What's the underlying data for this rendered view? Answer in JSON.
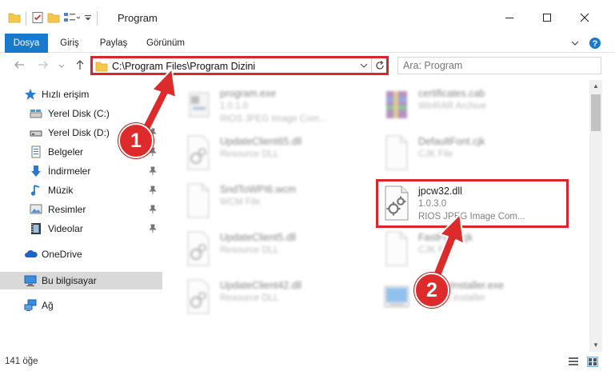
{
  "window": {
    "title": "Program",
    "controls": [
      "minimize-icon",
      "maximize-icon",
      "close-icon"
    ]
  },
  "ribbon": {
    "tabs": [
      {
        "label": "Dosya",
        "active": true
      },
      {
        "label": "Giriş"
      },
      {
        "label": "Paylaş"
      },
      {
        "label": "Görünüm"
      }
    ]
  },
  "navigation": {
    "address": "C:\\Program Files\\Program Dizini",
    "search_placeholder": "Ara: Program"
  },
  "sidebar": {
    "items": [
      {
        "label": "Hızlı erişim",
        "icon": "star-icon"
      },
      {
        "label": "Yerel Disk (C:)",
        "icon": "drive-icon",
        "pinned": true
      },
      {
        "label": "Yerel Disk (D:)",
        "icon": "drive-icon",
        "pinned": true
      },
      {
        "label": "Belgeler",
        "icon": "document-icon",
        "pinned": true
      },
      {
        "label": "İndirmeler",
        "icon": "download-icon",
        "pinned": true
      },
      {
        "label": "Müzik",
        "icon": "music-icon",
        "pinned": true
      },
      {
        "label": "Resimler",
        "icon": "image-icon",
        "pinned": true
      },
      {
        "label": "Videolar",
        "icon": "video-icon",
        "pinned": true
      },
      {
        "label": "OneDrive",
        "icon": "cloud-icon"
      },
      {
        "label": "Bu bilgisayar",
        "icon": "computer-icon",
        "selected": true
      },
      {
        "label": "Ağ",
        "icon": "network-icon"
      }
    ]
  },
  "files": [
    {
      "name": "program.exe",
      "line2": "1.0.1.0",
      "line3": "RIOS JPEG Image Com...",
      "icon": "exe-icon",
      "blurred": true
    },
    {
      "name": "certificates.cab",
      "line2": "WinRAR Archive",
      "line3": "",
      "icon": "archive-icon",
      "blurred": true
    },
    {
      "name": "UpdateClient65.dll",
      "line2": "Resource DLL",
      "line3": "",
      "icon": "dll-icon",
      "blurred": true
    },
    {
      "name": "DefaultFont.cjk",
      "line2": "CJK File",
      "line3": "",
      "icon": "blank-file-icon",
      "blurred": true
    },
    {
      "name": "SndToWPI6.wcm",
      "line2": "WCM File",
      "line3": "",
      "icon": "blank-file-icon",
      "blurred": true
    },
    {
      "name": "jpcw32.dll",
      "line2": "1.0.3.0",
      "line3": "RIOS JPEG Image Com...",
      "icon": "dll-icon",
      "blurred": false,
      "highlighted": true
    },
    {
      "name": "UpdateClient5.dll",
      "line2": "Resource DLL",
      "line3": "",
      "icon": "dll-icon",
      "blurred": true
    },
    {
      "name": "FastFont.cjk",
      "line2": "CJK File",
      "line3": "",
      "icon": "blank-file-icon",
      "blurred": true
    },
    {
      "name": "UpdateClient42.dll",
      "line2": "Resource DLL",
      "line3": "",
      "icon": "dll-icon",
      "blurred": true
    },
    {
      "name": "UpdateInstaller.exe",
      "line2": "updates installer",
      "line3": "",
      "icon": "installer-icon",
      "blurred": true
    }
  ],
  "status": {
    "item_count": "141 öğe"
  },
  "annotations": [
    {
      "number": "1",
      "color": "#dd2a2a"
    },
    {
      "number": "2",
      "color": "#dd2a2a"
    }
  ],
  "colors": {
    "accent": "#1979ca",
    "highlight_border": "#d9262a",
    "selected_bg": "#d9d9d9"
  }
}
